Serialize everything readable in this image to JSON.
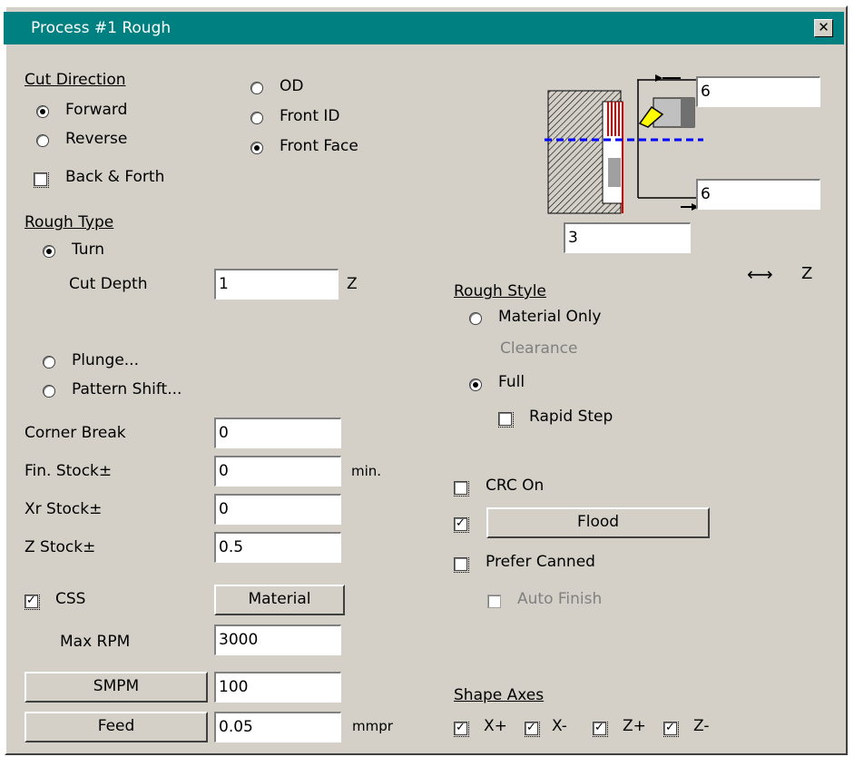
{
  "window": {
    "title": "Process #1 Rough",
    "close_label": "✕"
  },
  "cut_direction": {
    "heading": "Cut Direction",
    "forward": "Forward",
    "reverse": "Reverse",
    "back_forth": "Back & Forth",
    "selected": "Forward"
  },
  "location": {
    "od": "OD",
    "front_id": "Front ID",
    "front_face": "Front Face",
    "selected": "Front Face"
  },
  "diagram": {
    "top_value": "6",
    "right_value": "6",
    "bottom_value": "3",
    "axis_label": "Z"
  },
  "rough_type": {
    "heading": "Rough Type",
    "turn": "Turn",
    "cut_depth_label": "Cut Depth",
    "cut_depth_value": "1",
    "cut_depth_unit": "Z",
    "plunge": "Plunge...",
    "pattern_shift": "Pattern Shift...",
    "selected": "Turn"
  },
  "rough_style": {
    "heading": "Rough Style",
    "material_only": "Material Only",
    "clearance": "Clearance",
    "full": "Full",
    "rapid_step": "Rapid Step",
    "selected": "Full"
  },
  "params": {
    "corner_break_label": "Corner Break",
    "corner_break_value": "0",
    "fin_stock_label": "Fin. Stock±",
    "fin_stock_value": "0",
    "fin_stock_unit": "min.",
    "xr_stock_label": "Xr Stock±",
    "xr_stock_value": "0",
    "z_stock_label": "Z Stock±",
    "z_stock_value": "0.5",
    "css_label": "CSS",
    "material_button": "Material",
    "max_rpm_label": "Max RPM",
    "max_rpm_value": "3000",
    "smpm_button": "SMPM",
    "smpm_value": "100",
    "feed_button": "Feed",
    "feed_value": "0.05",
    "feed_unit": "mmpr"
  },
  "options": {
    "crc_on": "CRC On",
    "flood_button": "Flood",
    "prefer_canned": "Prefer Canned",
    "auto_finish": "Auto Finish"
  },
  "shape_axes": {
    "heading": "Shape Axes",
    "x_plus": "X+",
    "x_minus": "X-",
    "z_plus": "Z+",
    "z_minus": "Z-"
  },
  "check_glyph": "✓",
  "colors": {
    "title_bar": "#008080",
    "dialog_bg": "#d4d0c8",
    "red": "#e00000",
    "blue": "#0000ff",
    "insert_yellow": "#ffff00"
  }
}
